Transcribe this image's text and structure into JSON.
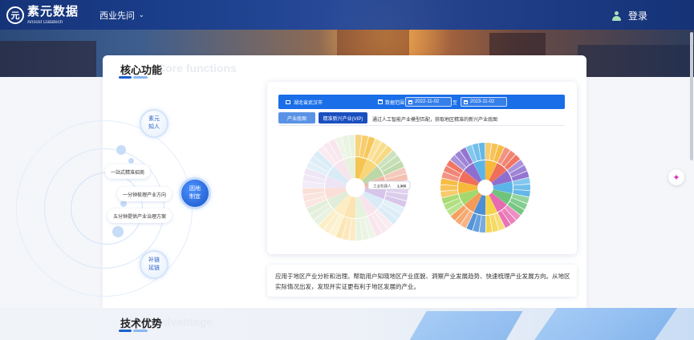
{
  "header": {
    "logo_mark": "元",
    "logo_cn": "素元数据",
    "logo_en": "Ansost Datatech",
    "nav_item": "西业先问",
    "login": "登录"
  },
  "core": {
    "title": "核心功能",
    "subtitle": "Core functions",
    "bubbles": {
      "top": "素元\n知人",
      "center": "因地\n制宜",
      "bottom": "补链\n延链"
    },
    "pills": [
      "一站式精准招商",
      "一分钟梳理产业方向",
      "五分钟提供产业治理方案"
    ]
  },
  "panel": {
    "location": "湖北省武汉市",
    "range_label": "数据范围",
    "date_start": "2022-11-02",
    "date_to": "至",
    "date_end": "2023-11-02",
    "tab_industry": "产业底图",
    "tab_vip": "精准新兴产业(VIP)",
    "tab_desc": "通过人工智能产业模型匹配，获取地区精准的新兴产业底图",
    "tooltip_name": "工业机器人",
    "tooltip_value": "1,365"
  },
  "description": "应用于地区产业分析和治理。帮助用户知晓地区产业底貌、洞察产业发展趋势、快速梳理产业发展方向。从地区实际情况出发，发现并实证更有利于地区发展的产业。",
  "advantage": {
    "title": "技术优势",
    "subtitle": "advantage"
  },
  "chart_data": {
    "type": "pie",
    "sunburst_left": [
      "#f6c453",
      "#f8d77a",
      "#bcd8a8",
      "#f1b7a6",
      "#d7c4ea",
      "#a9d3ea",
      "#efc3d6",
      "#c9e2b5"
    ],
    "sunburst_right": [
      "#f6b93b",
      "#ef6f5b",
      "#8e6fcf",
      "#5bb4e8",
      "#6fc47c",
      "#e86ab0",
      "#f3d34a",
      "#4b8fd8",
      "#f59b5a",
      "#a3d96c"
    ]
  }
}
